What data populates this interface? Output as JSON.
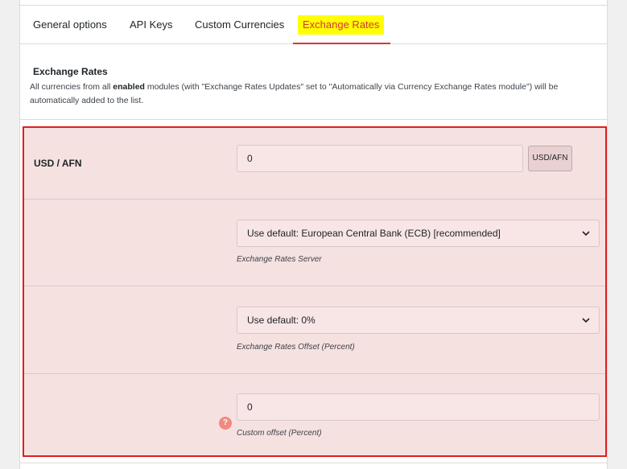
{
  "tabs": [
    {
      "label": "General options"
    },
    {
      "label": "API Keys"
    },
    {
      "label": "Custom Currencies"
    },
    {
      "label": "Exchange Rates"
    }
  ],
  "active_tab": "Exchange Rates",
  "section": {
    "title": "Exchange Rates",
    "desc_pre": "All currencies from all ",
    "desc_bold": "enabled",
    "desc_post": " modules (with \"Exchange Rates Updates\" set to \"Automatically via Currency Exchange Rates module\") will be automatically added to the list."
  },
  "rows": {
    "rate": {
      "label": "USD / AFN",
      "value": "0",
      "addon": "USD/AFN"
    },
    "server": {
      "value": "Use default: European Central Bank (ECB) [recommended]",
      "hint": "Exchange Rates Server"
    },
    "offset": {
      "value": "Use default: 0%",
      "hint": "Exchange Rates Offset (Percent)"
    },
    "custom_offset": {
      "value": "0",
      "hint": "Custom offset (Percent)",
      "help_glyph": "?"
    }
  },
  "colors": {
    "highlight": "#ffff00",
    "accent": "#d63638",
    "box_border": "#e01e1e",
    "box_bg": "#f6e1e1"
  }
}
